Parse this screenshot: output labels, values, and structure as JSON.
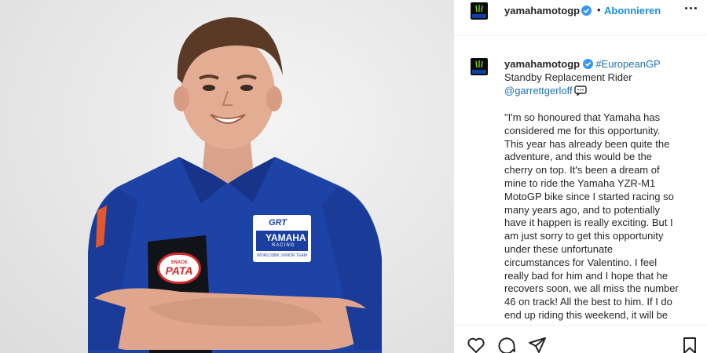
{
  "post": {
    "username": "yamahamotogp",
    "follow_label": "Abonnieren",
    "separator": "•",
    "caption": {
      "hashtag": "#EuropeanGP",
      "line2": "Standby Replacement Rider",
      "mention": "@garrettgerloff",
      "quote": "\"I'm so honoured that Yamaha has\nconsidered me for this opportunity.\nThis year has already been quite the\nadventure, and this would be the\ncherry on top. It's been a dream of\nmine to ride the Yamaha YZR-M1\nMotoGP bike since I started racing so\nmany years ago, and to potentially\nhave it happen is really exciting. But I\nam just sorry to get this opportunity\nunder these unfortunate\ncircumstances for Valentino. I feel\nreally bad for him and I hope that he\nrecovers soon, we all miss the number\n46 on track! All the best to him. If I do\nend up riding this weekend, it will be"
    },
    "image": {
      "sponsor_badge": "PATA",
      "sponsor_badge_top": "SNACK",
      "team_logo": "YAMAHA",
      "team_logo_sub": "RACING",
      "team_logo_footer": "WORLDSBK JUNIOR TEAM",
      "grt_logo": "GRT"
    },
    "icons": [
      "verified-icon",
      "more-icon",
      "comment-bubble-icon",
      "heart-icon",
      "comment-icon",
      "share-icon",
      "bookmark-icon"
    ],
    "colors": {
      "link": "#1f6fb8",
      "follow": "#1a8fd8",
      "shirt": "#1a3fa0",
      "verified": "#3897f0"
    }
  }
}
